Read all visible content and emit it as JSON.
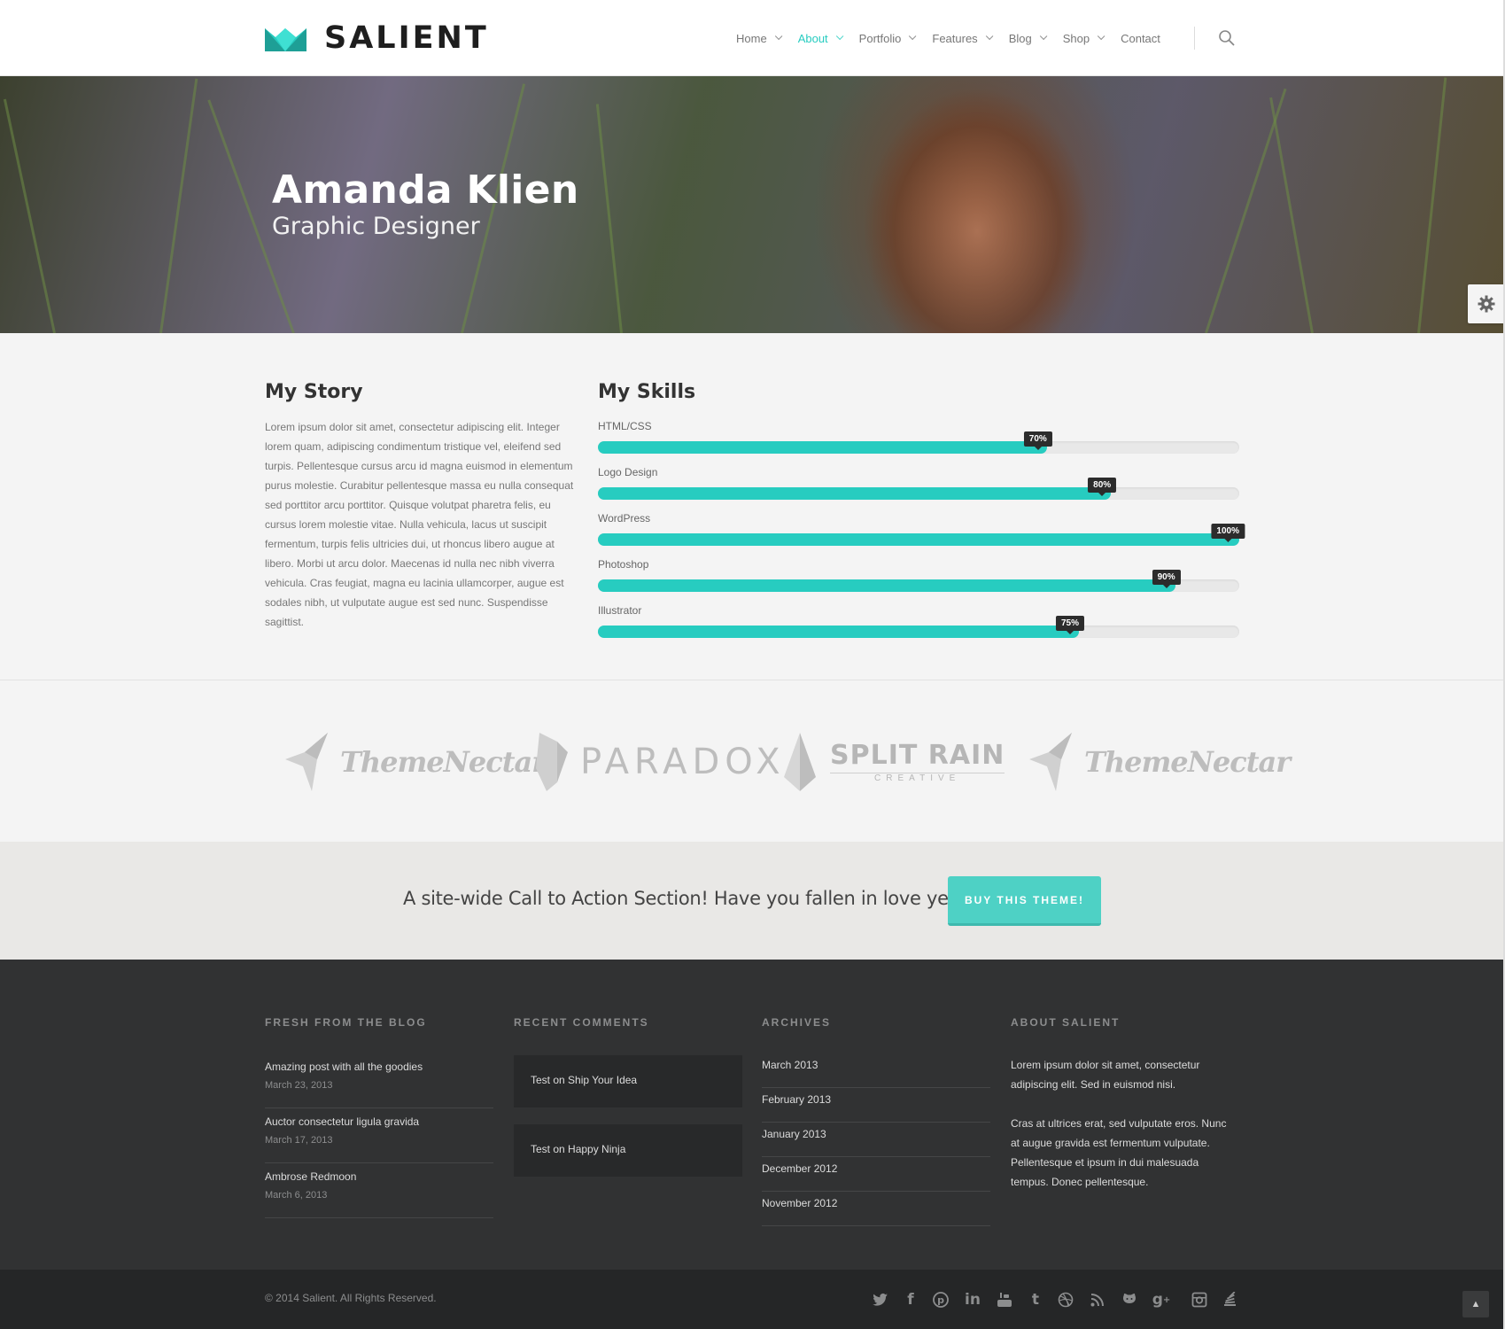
{
  "header": {
    "logo_text": "SALIENT",
    "nav": [
      {
        "label": "Home",
        "dropdown": true
      },
      {
        "label": "About",
        "dropdown": true,
        "active": true
      },
      {
        "label": "Portfolio",
        "dropdown": true
      },
      {
        "label": "Features",
        "dropdown": true
      },
      {
        "label": "Blog",
        "dropdown": true
      },
      {
        "label": "Shop",
        "dropdown": true
      },
      {
        "label": "Contact",
        "dropdown": false
      }
    ],
    "accent_color": "#27ccc0"
  },
  "hero": {
    "title": "Amanda Klien",
    "subtitle": "Graphic Designer"
  },
  "story": {
    "heading": "My Story",
    "text": "Lorem ipsum dolor sit amet, consectetur adipiscing elit. Integer lorem quam, adipiscing condimentum tristique vel, eleifend sed turpis. Pellentesque cursus arcu id magna euismod in elementum purus molestie. Curabitur pellentesque massa eu nulla consequat sed porttitor arcu porttitor. Quisque volutpat pharetra felis, eu cursus lorem molestie vitae. Nulla vehicula, lacus ut suscipit fermentum, turpis felis ultricies dui, ut rhoncus libero augue at libero. Morbi ut arcu dolor. Maecenas id nulla nec nibh viverra vehicula. Cras feugiat, magna eu lacinia ullamcorper, augue est sodales nibh, ut vulputate augue est sed nunc. Suspendisse sagittist."
  },
  "skills": {
    "heading": "My Skills",
    "items": [
      {
        "name": "HTML/CSS",
        "percent": 70,
        "label": "70%"
      },
      {
        "name": "Logo Design",
        "percent": 80,
        "label": "80%"
      },
      {
        "name": "WordPress",
        "percent": 100,
        "label": "100%"
      },
      {
        "name": "Photoshop",
        "percent": 90,
        "label": "90%"
      },
      {
        "name": "Illustrator",
        "percent": 75,
        "label": "75%"
      }
    ]
  },
  "clients": [
    {
      "name": "ThemeNectar"
    },
    {
      "name": "PARADOX"
    },
    {
      "name": "SPLIT RAIN",
      "tagline": "CREATIVE"
    },
    {
      "name": "ThemeNectar"
    }
  ],
  "cta": {
    "text": "A site-wide Call to Action Section! Have you fallen in love yet?",
    "button_label": "BUY THIS THEME!"
  },
  "footer": {
    "blog": {
      "title": "FRESH FROM THE BLOG",
      "posts": [
        {
          "title": "Amazing post with all the goodies",
          "date": "March 23, 2013"
        },
        {
          "title": "Auctor consectetur ligula gravida",
          "date": "March 17, 2013"
        },
        {
          "title": "Ambrose Redmoon",
          "date": "March 6, 2013"
        }
      ]
    },
    "comments": {
      "title": "RECENT COMMENTS",
      "items": [
        "Test on Ship Your Idea",
        "Test on Happy Ninja"
      ]
    },
    "archives": {
      "title": "ARCHIVES",
      "items": [
        "March 2013",
        "February 2013",
        "January 2013",
        "December 2012",
        "November 2012"
      ]
    },
    "about": {
      "title": "ABOUT SALIENT",
      "para1": "Lorem ipsum dolor sit amet, consectetur adipiscing elit. Sed in euismod nisi.",
      "para2": "Cras at ultrices erat, sed vulputate eros. Nunc at augue gravida est fermentum vulputate. Pellentesque et ipsum in dui malesuada tempus. Donec pellentesque."
    }
  },
  "bottom_bar": {
    "copyright": "© 2014 Salient. All Rights Reserved.",
    "social_icons": [
      "twitter-icon",
      "facebook-icon",
      "pinterest-icon",
      "linkedin-icon",
      "youtube-icon",
      "tumblr-icon",
      "dribbble-icon",
      "rss-icon",
      "github-icon",
      "google-plus-icon",
      "instagram-icon",
      "stackexchange-icon"
    ]
  }
}
